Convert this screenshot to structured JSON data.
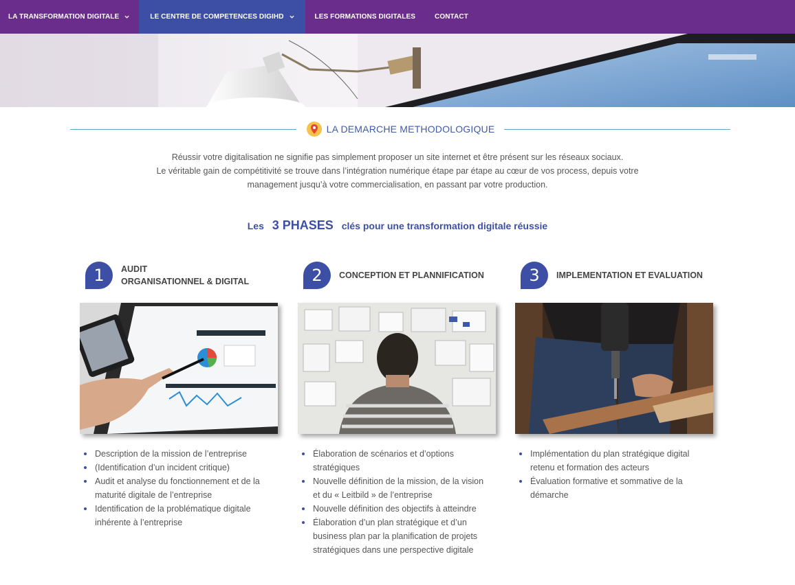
{
  "nav": {
    "items": [
      {
        "label": "LA TRANSFORMATION DIGITALE",
        "has_dropdown": true,
        "active": false
      },
      {
        "label": "LE CENTRE DE COMPETENCES DIGIHD",
        "has_dropdown": true,
        "active": true
      },
      {
        "label": "LES FORMATIONS DIGITALES",
        "has_dropdown": false,
        "active": false
      },
      {
        "label": "CONTACT",
        "has_dropdown": false,
        "active": false
      }
    ]
  },
  "section": {
    "title": "LA DEMARCHE METHODOLOGIQUE",
    "icon": "location-pin-icon",
    "intro_lines": [
      "Réussir votre digitalisation ne signifie pas simplement proposer un site internet et être présent sur les réseaux sociaux.",
      "Le véritable gain de compétitivité se trouve dans l’intégration numérique étape par étape au cœur de vos process, depuis votre",
      "management jusqu’à votre commercialisation, en passant par votre production."
    ]
  },
  "phases_title": {
    "prefix": "Les",
    "highlight": "3 PHASES",
    "suffix": "clés pour une transformation digitale réussie"
  },
  "phases": [
    {
      "number": "1",
      "title_lines": [
        "AUDIT",
        "ORGANISATIONNEL & DIGITAL"
      ],
      "image": "tablet-analytics-image",
      "items": [
        "Description de la mission de l’entreprise",
        "(Identification d’un incident critique)",
        "Audit et analyse du fonctionnement et de la maturité digitale de l’entreprise",
        "Identification de la problématique digitale inhérente à l’entreprise"
      ]
    },
    {
      "number": "2",
      "title_lines": [
        "CONCEPTION ET PLANNIFICATION"
      ],
      "image": "planning-wall-image",
      "items": [
        "Élaboration de scénarios et d’options stratégiques",
        "Nouvelle définition de la mission, de la vision et du « Leitbild » de l’entreprise",
        "Nouvelle définition des objectifs à atteindre",
        "Élaboration d’un plan stratégique et d’un business plan par la planification de projets stratégiques dans une perspective digitale"
      ]
    },
    {
      "number": "3",
      "title_lines": [
        "IMPLEMENTATION ET EVALUATION"
      ],
      "image": "drilling-wood-image",
      "items": [
        "Implémentation du plan stratégique digital retenu et formation des acteurs",
        "Évaluation formative et sommative de la démarche"
      ]
    }
  ],
  "colors": {
    "nav_bg": "#6b2d8b",
    "nav_active": "#3d4fa5",
    "accent_blue": "#3d4fa5",
    "rule_line": "#5aa7c8"
  }
}
